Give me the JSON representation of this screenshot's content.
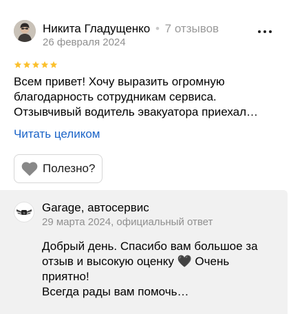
{
  "review": {
    "author": {
      "name": "Никита Гладущенко",
      "reviews_count": "7 отзывов"
    },
    "date": "26 февраля 2024",
    "rating": 5,
    "rating_max": 5,
    "text_lines": [
      "Всем привет! Хочу выразить огромную",
      "благодарность сотрудникам сервиса.",
      "Отзывчивый водитель эвакуатора приехал…"
    ],
    "read_more_label": "Читать целиком",
    "helpful_label": "Полезно?"
  },
  "reply": {
    "company_name": "Garage, автосервис",
    "meta": "29 марта 2024, официальный ответ",
    "text_lines": [
      "Добрый день. Спасибо вам большое за",
      "отзыв и высокую оценку 🖤 Очень",
      "приятно!",
      "Всегда рады вам помочь…"
    ]
  },
  "colors": {
    "star": "#fbc02d",
    "link": "#1a63c7",
    "secondary_text": "#8f8f8f",
    "reply_background": "#f1f1f1",
    "heart_icon": "#888888"
  },
  "icons": {
    "more": "more-icon",
    "star": "star-icon",
    "helpful": "heart-icon",
    "company_logo": "garage-logo-icon"
  }
}
